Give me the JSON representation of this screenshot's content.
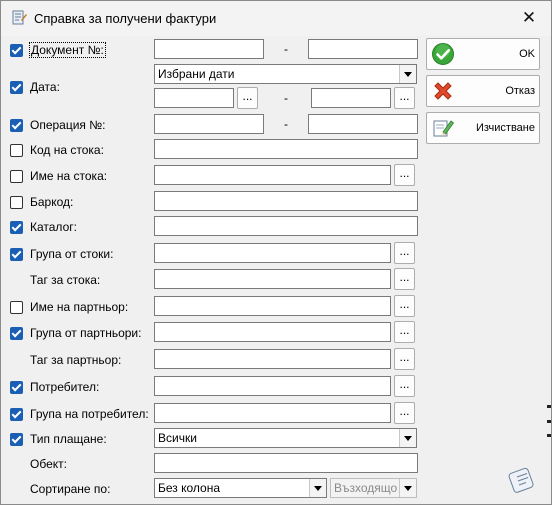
{
  "window": {
    "title": "Справка за получени фактури"
  },
  "buttons": {
    "ok": "OK",
    "cancel": "Отказ",
    "clear": "Изчистване",
    "browse": "..."
  },
  "form": {
    "dash": "-",
    "document_no": {
      "label": "Документ №:",
      "checked": true,
      "from": "",
      "to": ""
    },
    "date": {
      "label": "Дата:",
      "checked": true,
      "mode": "Избрани дати",
      "from": "",
      "to": ""
    },
    "operation_no": {
      "label": "Операция №:",
      "checked": true,
      "from": "",
      "to": ""
    },
    "item_code": {
      "label": "Код на стока:",
      "checked": false,
      "value": ""
    },
    "item_name": {
      "label": "Име на стока:",
      "checked": false,
      "value": ""
    },
    "barcode": {
      "label": "Баркод:",
      "checked": false,
      "value": ""
    },
    "catalog": {
      "label": "Каталог:",
      "checked": true,
      "value": ""
    },
    "item_group": {
      "label": "Група от стоки:",
      "checked": true,
      "value": ""
    },
    "item_tag": {
      "label": "Таг за стока:",
      "value": ""
    },
    "partner_name": {
      "label": "Име на партньор:",
      "checked": false,
      "value": ""
    },
    "partner_group": {
      "label": "Група от партньори:",
      "checked": true,
      "value": ""
    },
    "partner_tag": {
      "label": "Таг за партньор:",
      "value": ""
    },
    "user": {
      "label": "Потребител:",
      "checked": true,
      "value": ""
    },
    "user_group": {
      "label": "Група на потребител:",
      "checked": true,
      "value": ""
    },
    "payment_type": {
      "label": "Тип плащане:",
      "checked": true,
      "value": "Всички"
    },
    "object": {
      "label": "Обект:",
      "value": ""
    },
    "sort": {
      "label": "Сортиране по:",
      "column": "Без колона",
      "direction": "Възходящо"
    }
  },
  "icons": {
    "app": "invoice-scroll-icon",
    "ok": "green-check-icon",
    "cancel": "red-x-icon",
    "clear": "eraser-icon",
    "footer": "scroll-icon"
  },
  "colors": {
    "checkbox": "#1a5fb4",
    "ok_icon": "#3aa63a",
    "cancel_icon": "#e04a2a"
  }
}
